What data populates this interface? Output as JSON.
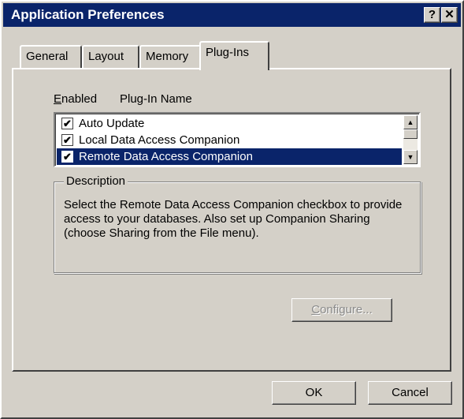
{
  "window": {
    "title": "Application Preferences",
    "help_button": "?",
    "close_button": "✕"
  },
  "tabs": [
    {
      "label": "General",
      "active": false
    },
    {
      "label": "Layout",
      "active": false
    },
    {
      "label": "Memory",
      "active": false
    },
    {
      "label": "Plug-Ins",
      "active": true
    }
  ],
  "plugins": {
    "column_enabled_accel": "E",
    "column_enabled_rest": "nabled",
    "column_name": "Plug-In Name",
    "items": [
      {
        "name": "Auto Update",
        "enabled": true,
        "selected": false
      },
      {
        "name": "Local Data Access Companion",
        "enabled": true,
        "selected": false
      },
      {
        "name": "Remote Data Access Companion",
        "enabled": true,
        "selected": true
      }
    ],
    "check_glyph": "✔"
  },
  "description": {
    "title": "Description",
    "text": "Select the Remote Data Access Companion checkbox to provide access to your databases. Also set up Companion Sharing (choose Sharing from the File menu)."
  },
  "buttons": {
    "configure_accel": "C",
    "configure_rest": "onfigure...",
    "configure_enabled": false,
    "ok": "OK",
    "cancel": "Cancel"
  },
  "colors": {
    "titlebar": "#0a246a",
    "face": "#d4d0c8",
    "selection": "#0a246a"
  }
}
